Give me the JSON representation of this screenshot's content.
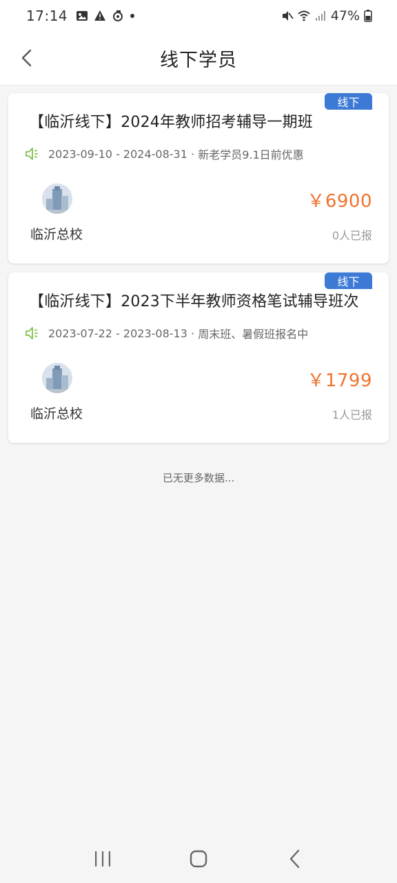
{
  "status_bar": {
    "time": "17:14",
    "battery": "47%"
  },
  "header": {
    "title": "线下学员",
    "back_icon": "chevron-left-icon"
  },
  "courses": [
    {
      "tag": "线下",
      "title": "【临沂线下】2024年教师招考辅导一期班",
      "date_range": "2023-09-10 - 2024-08-31",
      "separator": " · ",
      "note": "新老学员9.1日前优惠",
      "school": "临沂总校",
      "price": "￥6900",
      "enrolled": "0人已报"
    },
    {
      "tag": "线下",
      "title": "【临沂线下】2023下半年教师资格笔试辅导班次",
      "date_range": "2023-07-22 - 2023-08-13",
      "separator": " · ",
      "note": "周末班、暑假班报名中",
      "school": "临沂总校",
      "price": "￥1799",
      "enrolled": "1人已报"
    }
  ],
  "footer_text": "已无更多数据...",
  "colors": {
    "tag_bg": "#3d7ad6",
    "price": "#f0732d",
    "speaker": "#7cc04a"
  }
}
